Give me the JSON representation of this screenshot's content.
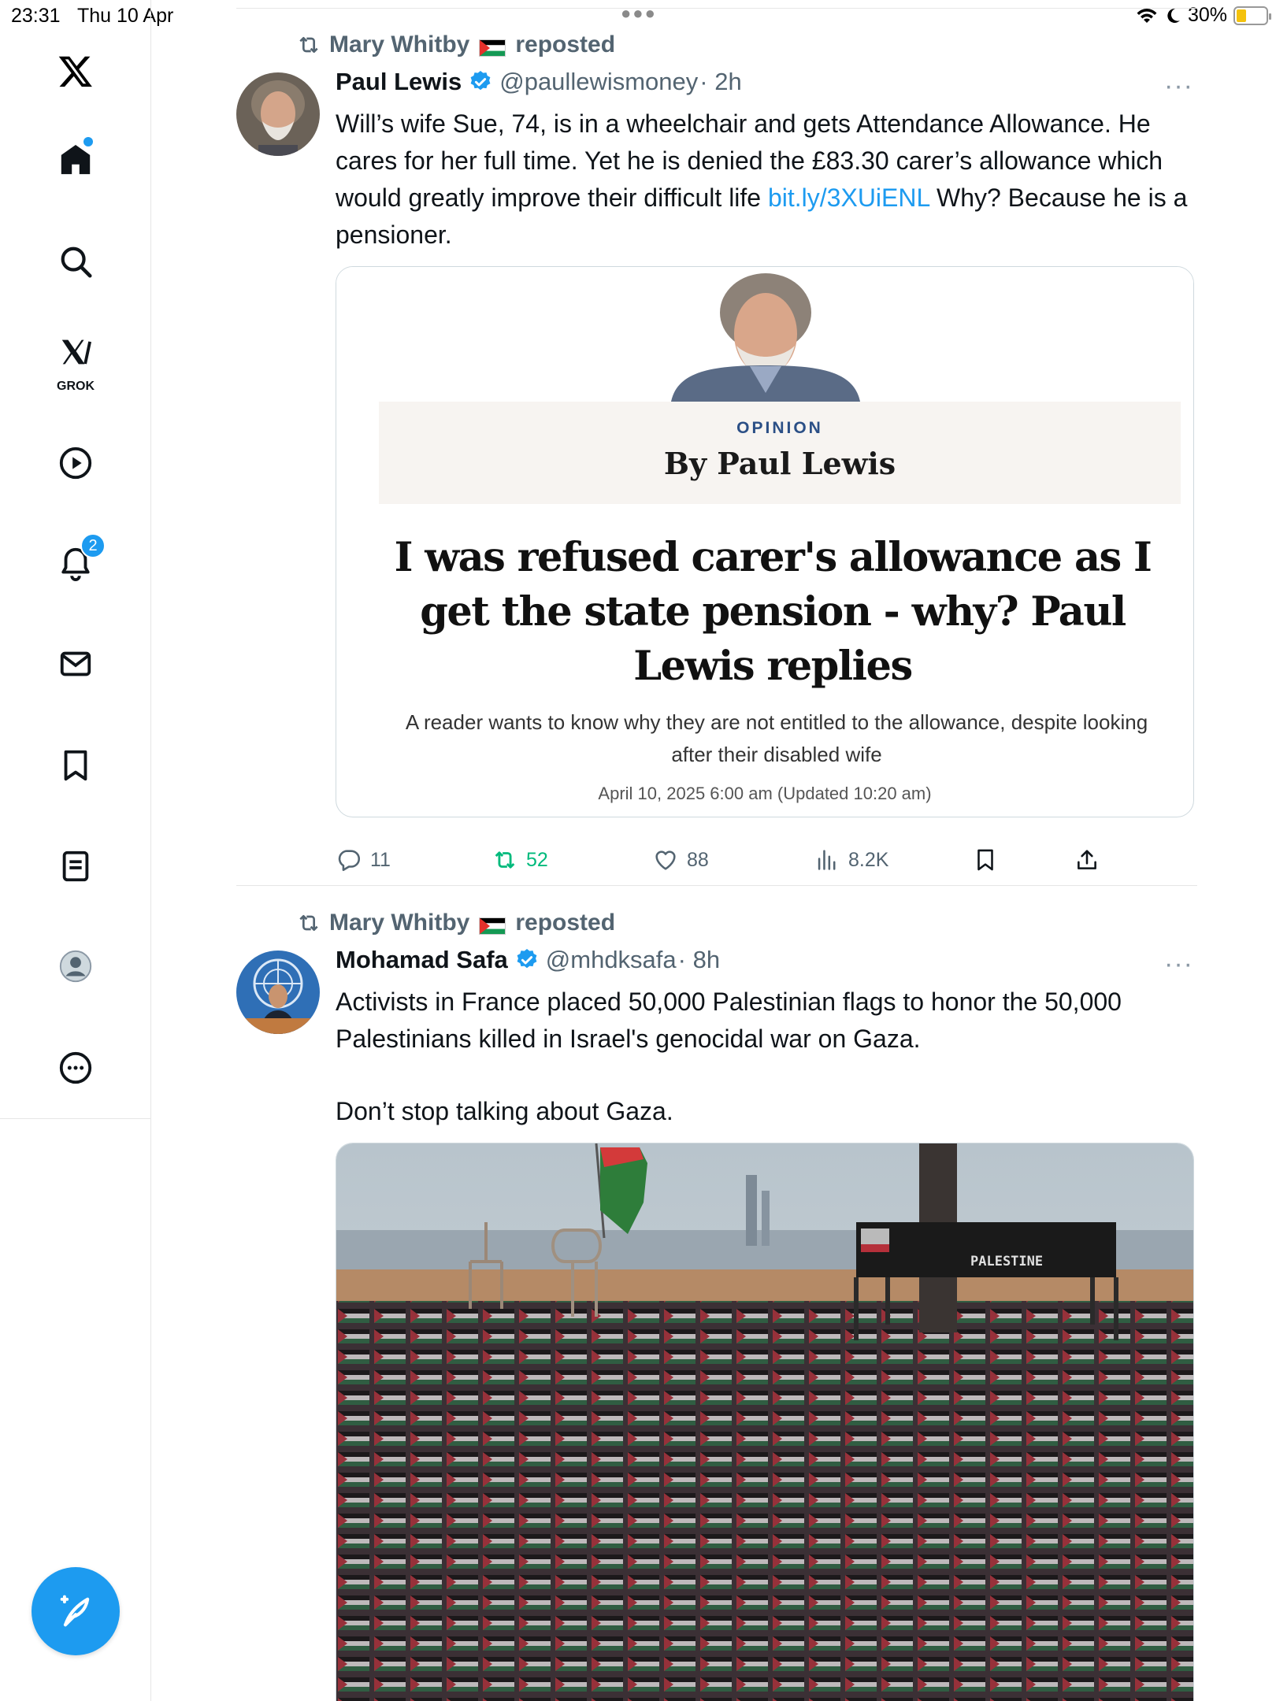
{
  "status_bar": {
    "time": "23:31",
    "date": "Thu 10 Apr",
    "battery": "30%",
    "battery_level": 0.3
  },
  "sidebar": {
    "logo": "x-logo-icon",
    "items": [
      {
        "name": "home",
        "icon": "home-icon",
        "has_dot": true
      },
      {
        "name": "search",
        "icon": "search-icon"
      },
      {
        "name": "grok",
        "icon": "grok-icon",
        "label": "GROK"
      },
      {
        "name": "video",
        "icon": "play-icon"
      },
      {
        "name": "notifications",
        "icon": "bell-icon",
        "badge": "2"
      },
      {
        "name": "messages",
        "icon": "mail-icon"
      },
      {
        "name": "bookmarks",
        "icon": "bookmark-icon"
      },
      {
        "name": "lists",
        "icon": "list-icon"
      },
      {
        "name": "profile",
        "icon": "profile-icon"
      },
      {
        "name": "more",
        "icon": "more-circle-icon"
      }
    ],
    "compose_icon": "compose-icon"
  },
  "tweets": [
    {
      "repost_user": "Mary Whitby",
      "repost_suffix": "reposted",
      "author_name": "Paul Lewis",
      "verified": true,
      "handle": "@paullewismoney",
      "time": "· 2h",
      "text_before_link": "Will’s wife Sue, 74, is in a wheelchair and gets Attendance Allowance. He cares for her full time. Yet he is denied the £83.30 carer’s allowance which would greatly improve their difficult life ",
      "link": "bit.ly/3XUiENL",
      "text_after_link": " Why? Because he is a pensioner.",
      "card": {
        "kicker": "OPINION",
        "byline": "By Paul Lewis",
        "headline": "I was refused carer's allowance as I get the state pension - why? Paul Lewis replies",
        "standfirst": "A reader wants to know why they are not entitled to the allowance, despite looking after their disabled wife",
        "date": "April 10, 2025 6:00 am (Updated 10:20 am)"
      },
      "stats": {
        "replies": "11",
        "reposts": "52",
        "likes": "88",
        "views": "8.2K"
      }
    },
    {
      "repost_user": "Mary Whitby",
      "repost_suffix": "reposted",
      "author_name": "Mohamad Safa",
      "verified": true,
      "handle": "@mhdksafa",
      "time": "· 8h",
      "text": "Activists in France placed 50,000 Palestinian flags to honor the 50,000 Palestinians killed in Israel's genocidal war on Gaza.",
      "text2": "Don’t stop talking about Gaza.",
      "media_sign_text": "PALESTINE"
    }
  ],
  "colors": {
    "accent": "#1d9bf0",
    "repost_green": "#00ba7c",
    "muted": "#536471"
  }
}
